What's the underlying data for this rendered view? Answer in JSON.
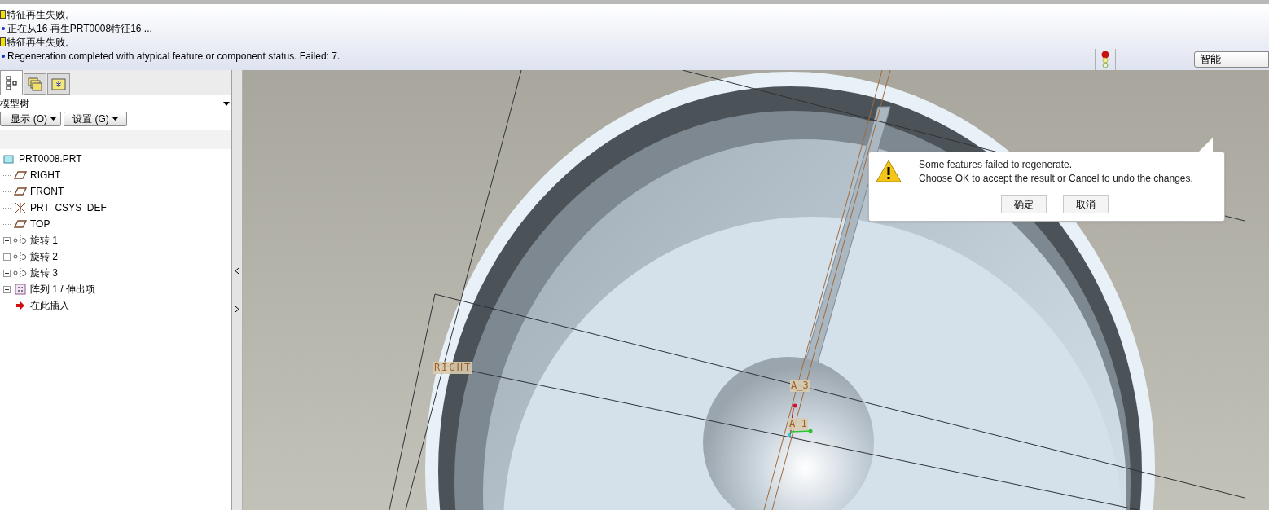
{
  "messages": [
    {
      "kind": "error",
      "text": "特征再生失败。"
    },
    {
      "kind": "info",
      "text": "正在从16 再生PRT0008特征16 ..."
    },
    {
      "kind": "error",
      "text": "特征再生失败。"
    },
    {
      "kind": "info",
      "text": "Regeneration completed with atypical feature or component status. Failed: 7."
    }
  ],
  "status_bar": {
    "filter": "智能"
  },
  "model_tree": {
    "tabs": [
      {
        "kind": "tree",
        "selected": true
      },
      {
        "kind": "folders",
        "selected": false
      },
      {
        "kind": "favorites",
        "selected": false
      }
    ],
    "title": "模型树",
    "buttons": [
      "显示 (O)",
      "设置 (G)"
    ],
    "items": [
      {
        "kind": "part",
        "label": "PRT0008.PRT",
        "children": [
          {
            "kind": "plane",
            "label": "RIGHT"
          },
          {
            "kind": "plane",
            "label": "FRONT"
          },
          {
            "kind": "csys",
            "label": "PRT_CSYS_DEF"
          },
          {
            "kind": "plane",
            "label": "TOP"
          },
          {
            "kind": "revolve",
            "label": "旋转 1",
            "expanded": false
          },
          {
            "kind": "revolve",
            "label": "旋转 2",
            "expanded": false
          },
          {
            "kind": "revolve",
            "label": "旋转 3",
            "expanded": false
          },
          {
            "kind": "pattern",
            "label": "阵列 1 / 伸出项",
            "expanded": false
          },
          {
            "kind": "insert",
            "label": "在此插入"
          }
        ]
      }
    ]
  },
  "viewport": {
    "datum_labels": [
      {
        "kind": "plane",
        "text": "RIGHT"
      },
      {
        "kind": "axis",
        "text": "A_3"
      },
      {
        "kind": "axis",
        "text": "A_1"
      }
    ]
  },
  "dialog": {
    "kind": "warning",
    "lines": [
      "Some features failed to regenerate.",
      "Choose OK to accept the result or Cancel to undo the changes."
    ],
    "buttons": [
      "确定",
      "取消"
    ]
  }
}
